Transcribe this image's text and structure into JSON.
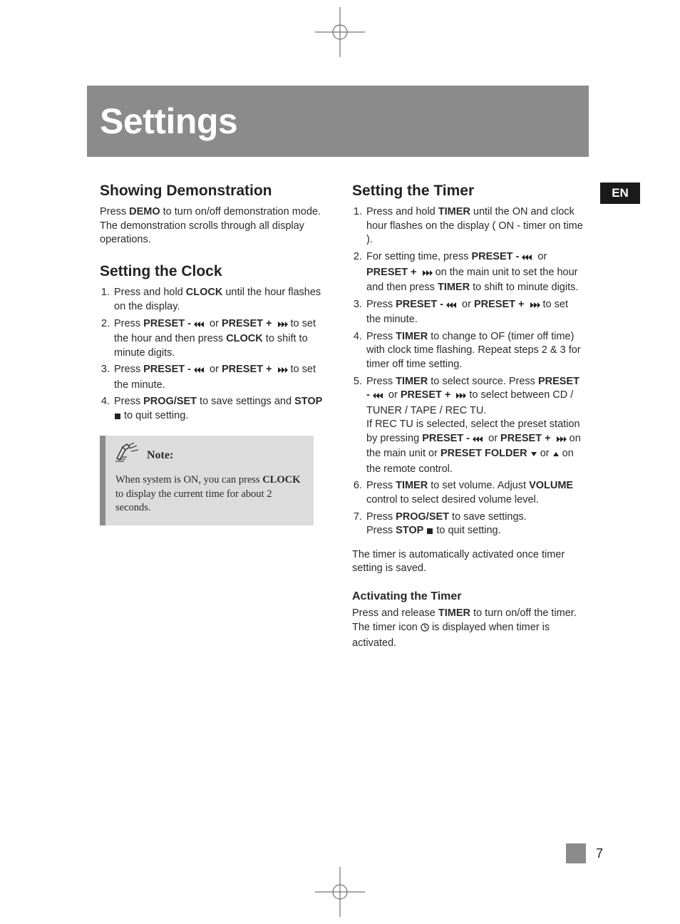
{
  "page_title": "Settings",
  "language_tab": "EN",
  "page_number": "7",
  "left": {
    "section1_heading": "Showing Demonstration",
    "section1_text_parts": {
      "a": "Press ",
      "b_demo": "DEMO",
      "c": " to turn on/off demonstration mode. The demonstration scrolls through all display operations."
    },
    "section2_heading": "Setting the Clock",
    "clock_steps": {
      "s1": {
        "a": "Press and hold ",
        "b": "CLOCK",
        "c": " until the hour flashes on the display."
      },
      "s2": {
        "a": "Press ",
        "b": "PRESET -",
        "c": " or ",
        "d": "PRESET +",
        "e": " to set the hour and then press ",
        "f": "CLOCK",
        "g": " to shift to minute digits."
      },
      "s3": {
        "a": "Press ",
        "b": "PRESET -",
        "c": " or ",
        "d": "PRESET +",
        "e": " to set the minute."
      },
      "s4": {
        "a": "Press ",
        "b": "PROG/SET",
        "c": " to save settings and ",
        "d": "STOP",
        "e": " to quit setting."
      }
    },
    "note_label": "Note:",
    "note_body_parts": {
      "a": "When system is ON, you can press ",
      "b_clock": "CLOCK",
      "c": " to display the current time for about 2 seconds."
    }
  },
  "right": {
    "section_heading": "Setting the Timer",
    "timer_steps": {
      "s1": {
        "a": "Press and hold ",
        "b": "TIMER",
        "c": " until the ON and clock hour flashes on the display ( ON  - timer on time )."
      },
      "s2": {
        "a": "For setting time, press ",
        "b": "PRESET -",
        "c": " or ",
        "d": "PRESET +",
        "e": " on the main unit to set the hour and then press ",
        "f": "TIMER",
        "g": " to shift to minute digits."
      },
      "s3": {
        "a": "Press ",
        "b": "PRESET -",
        "c": " or ",
        "d": "PRESET +",
        "e": " to set the minute."
      },
      "s4": {
        "a": "Press ",
        "b": "TIMER",
        "c": " to change to OF (timer off time) with clock time flashing. Repeat steps 2 & 3 for timer off time setting."
      },
      "s5": {
        "a": "Press ",
        "b": "TIMER",
        "c": " to select source.  Press ",
        "d": "PRESET -",
        "e": " or ",
        "f": "PRESET +",
        "g": " to select between CD  / TUNER  / TAPE  / REC TU.",
        "h": "If REC TU is selected, select the preset station by pressing ",
        "i": "PRESET -",
        "j": " or ",
        "k": "PRESET +",
        "l": " on the main unit or ",
        "m": "PRESET FOLDER",
        "n": " or ",
        "o": " on the remote control."
      },
      "s6": {
        "a": "Press ",
        "b": "TIMER",
        "c": " to set volume.  Adjust ",
        "d": "VOLUME",
        "e": " control to select desired volume level."
      },
      "s7": {
        "a": "Press ",
        "b": "PROG/SET",
        "c": " to save settings.",
        "d": "Press ",
        "e": "STOP",
        "f": " to quit setting."
      }
    },
    "after_steps": "The timer is automatically activated once timer setting is saved.",
    "subsection_heading": "Activating the Timer",
    "activate_parts": {
      "a": "Press and release ",
      "b": "TIMER",
      "c": " to turn on/off the timer. The timer icon ",
      "d": " is displayed when timer is activated."
    }
  },
  "icons": {
    "skip_back": "skip-back-icon",
    "skip_fwd": "skip-forward-icon",
    "stop": "stop-icon",
    "down": "triangle-down-icon",
    "up": "triangle-up-icon",
    "clock": "clock-icon",
    "note_hand": "hand-writing-icon",
    "crop": "registration-mark-icon"
  }
}
